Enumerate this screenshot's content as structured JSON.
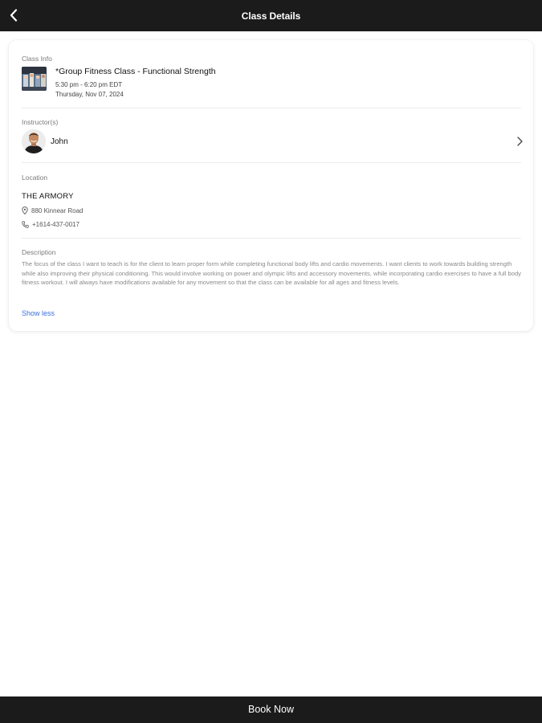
{
  "header": {
    "title": "Class Details",
    "back_icon": "chevron-left-icon"
  },
  "class_info": {
    "label": "Class Info",
    "title": "*Group Fitness Class - Functional Strength",
    "time": "5:30 pm - 6:20 pm EDT",
    "date": "Thursday, Nov 07, 2024"
  },
  "instructors": {
    "label": "Instructor(s)",
    "name": "John",
    "chevron_icon": "chevron-right-icon"
  },
  "location": {
    "label": "Location",
    "name": "THE ARMORY",
    "address": "880 Kinnear Road",
    "phone": "+1614-437-0017",
    "address_icon": "map-pin-icon",
    "phone_icon": "phone-icon"
  },
  "description": {
    "label": "Description",
    "text": "The focus of the class I want to teach is for the client to learn proper form while completing functional body lifts and cardio movements. I want clients to work towards building strength while also improving their physical conditioning. This would involve working on power and olympic lifts and accessory movements, while incorporating cardio exercises to have a full body fitness workout. I will always have modifications available for any movement so that the class can be available for all ages and fitness levels.",
    "toggle_label": "Show less"
  },
  "footer": {
    "book_label": "Book Now"
  },
  "colors": {
    "bar_background": "#1b1b1b",
    "link": "#3b6fd8"
  }
}
